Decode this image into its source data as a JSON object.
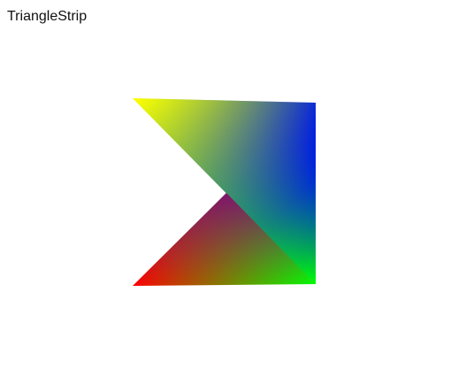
{
  "window": {
    "title": "TriangleStrip"
  },
  "render": {
    "mode": "triangle-strip",
    "vertex_colors": [
      "#ffff00",
      "#ff0000",
      "#0000ff",
      "#00ff00"
    ]
  }
}
